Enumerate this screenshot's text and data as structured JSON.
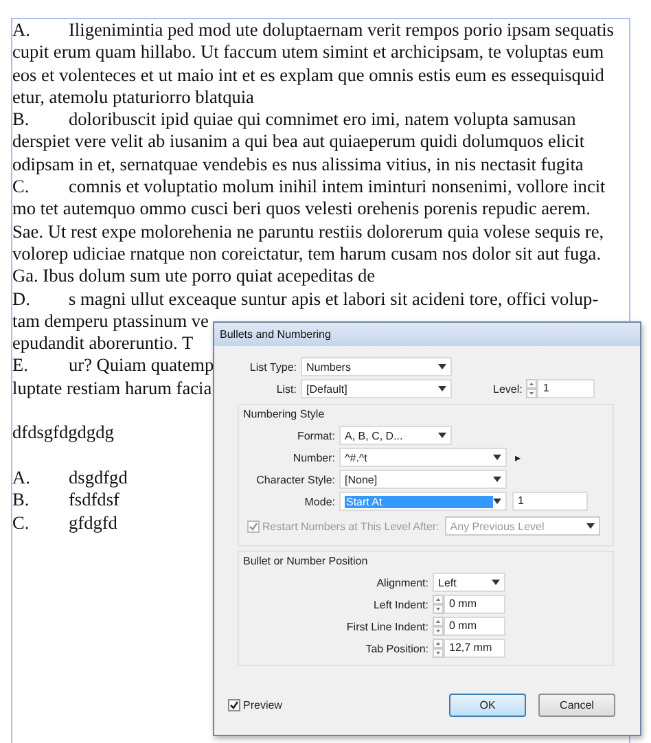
{
  "document": {
    "paragraphs": [
      {
        "kind": "item",
        "marker": "A.",
        "lines": [
          "Iligenimintia ped mod ute doluptaernam verit rempos porio ipsam sequatis",
          "cupit erum quam hillabo. Ut faccum utem simint et archicipsam, te voluptas eum",
          "eos et volenteces et ut maio int et es explam que omnis estis eum es essequisquid",
          "etur, atemolu ptaturiorro blatquia"
        ]
      },
      {
        "kind": "item",
        "marker": "B.",
        "lines": [
          "doloribuscit ipid quiae qui comnimet ero imi, natem volupta samusan",
          "derspiet vere velit ab iusanim a qui bea aut quiaeperum quidi dolumquos elicit",
          "odipsam in et, sernatquae vendebis es nus alissima vitius, in nis nectasit fugita"
        ]
      },
      {
        "kind": "item",
        "marker": "C.",
        "lines": [
          "comnis et voluptatio molum inihil intem iminturi nonsenimi, vollore incit",
          "mo tet autemquo ommo cusci beri quos velesti orehenis porenis repudic aerem.",
          "Sae. Ut rest expe molorehenia ne paruntu restiis dolorerum quia volese sequis re,",
          "volorep udiciae rnatque non coreictatur, tem harum cusam nos dolor sit aut fuga.",
          "Ga. Ibus dolum sum ute porro quiat acepeditas de"
        ]
      },
      {
        "kind": "item",
        "marker": "D.",
        "lines": [
          "s magni ullut exceaque suntur apis et labori sit acideni tore, offici volup-",
          "tam demperu ptassinum ve",
          "epudandit aboreruntio. T"
        ]
      },
      {
        "kind": "item",
        "marker": "E.",
        "lines": [
          "ur? Quiam quatemp",
          "luptate restiam harum facia"
        ]
      },
      {
        "kind": "blank"
      },
      {
        "kind": "plain",
        "lines": [
          "dfdsgfdgdgdg"
        ]
      },
      {
        "kind": "blank"
      },
      {
        "kind": "item",
        "marker": "A.",
        "lines": [
          "dsgdfgd"
        ]
      },
      {
        "kind": "item",
        "marker": "B.",
        "lines": [
          "fsdfdsf"
        ]
      },
      {
        "kind": "item",
        "marker": "C.",
        "lines": [
          "gfdgfd"
        ]
      }
    ]
  },
  "dialog": {
    "title": "Bullets and Numbering",
    "top_rows": [
      {
        "label": "List Type:",
        "control": {
          "kind": "select",
          "value": "Numbers"
        }
      },
      {
        "label": "List:",
        "control": {
          "kind": "select",
          "value": "[Default]"
        },
        "side": {
          "label": "Level:",
          "control": {
            "kind": "spinner",
            "value": "1"
          }
        }
      }
    ],
    "numbering_style": {
      "title": "Numbering Style",
      "rows": [
        {
          "label": "Format:",
          "control": {
            "kind": "select",
            "value": "A, B, C, D..."
          }
        },
        {
          "label": "Number:",
          "control": {
            "kind": "select",
            "value": "^#.^t"
          },
          "menu_arrow": "▸"
        },
        {
          "label": "Character Style:",
          "control": {
            "kind": "select",
            "value": "[None]"
          }
        },
        {
          "label": "Mode:",
          "control": {
            "kind": "select",
            "value": "Start At",
            "highlighted": true
          },
          "extra_field": "1"
        }
      ],
      "restart": {
        "label": "Restart Numbers at This Level After:",
        "checked": true,
        "disabled": true,
        "value": "Any Previous Level"
      }
    },
    "position": {
      "title": "Bullet or Number Position",
      "rows": [
        {
          "label": "Alignment:",
          "control": {
            "kind": "select",
            "value": "Left"
          }
        },
        {
          "label": "Left Indent:",
          "control": {
            "kind": "spinner",
            "value": "0 mm"
          }
        },
        {
          "label": "First Line Indent:",
          "control": {
            "kind": "spinner",
            "value": "0 mm"
          }
        },
        {
          "label": "Tab Position:",
          "control": {
            "kind": "spinner",
            "value": "12,7 mm"
          }
        }
      ]
    },
    "preview": {
      "label": "Preview",
      "checked": true
    },
    "buttons": [
      {
        "label": "OK",
        "default": true
      },
      {
        "label": "Cancel",
        "default": false
      }
    ]
  }
}
